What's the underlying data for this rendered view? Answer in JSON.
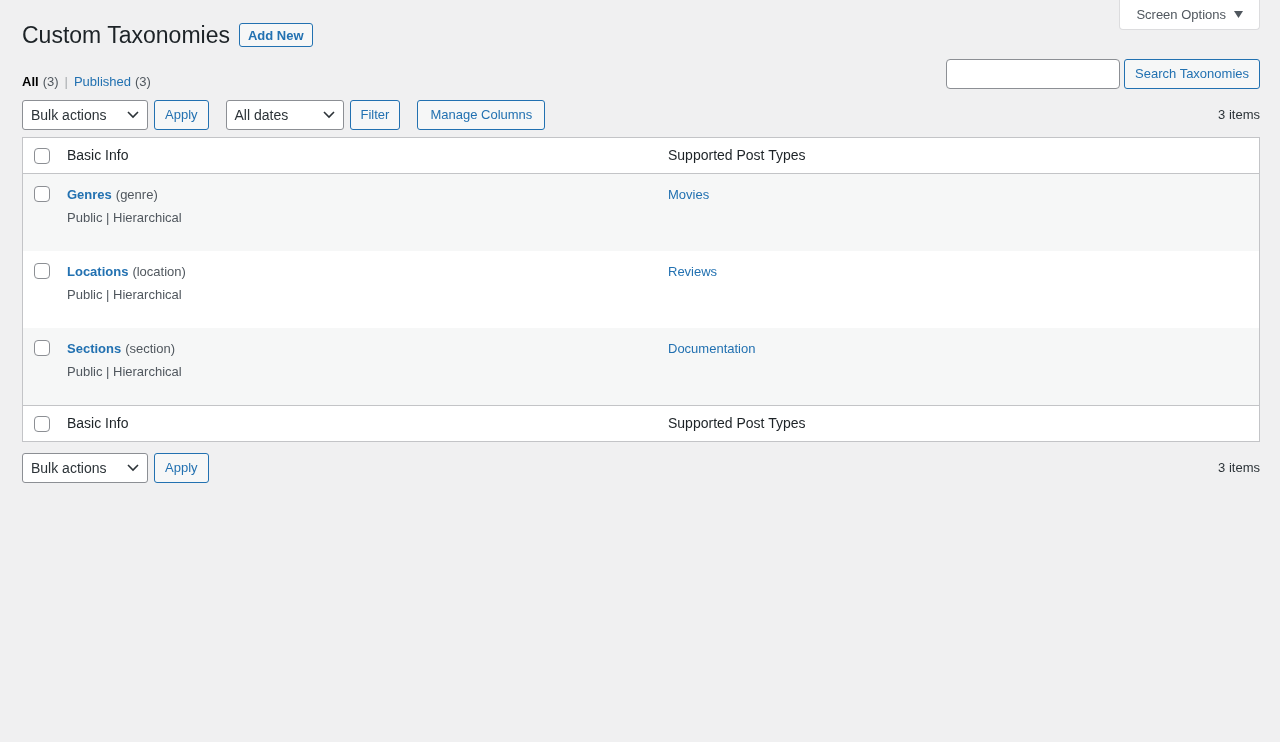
{
  "screen_options": {
    "label": "Screen Options",
    "expanded": false
  },
  "page_title": "Custom Taxonomies",
  "add_new": "Add New",
  "views": [
    {
      "label": "All",
      "count": "(3)",
      "selected": true
    },
    {
      "label": "Published",
      "count": "(3)",
      "selected": false
    }
  ],
  "view_separator": "|",
  "search": {
    "button": "Search Taxonomies"
  },
  "top_nav": {
    "bulk_actions": "Bulk actions",
    "apply": "Apply",
    "dates": "All dates",
    "filter": "Filter",
    "manage_columns": "Manage Columns",
    "count": "3 items"
  },
  "table": {
    "columns": [
      "Basic Info",
      "Supported Post Types"
    ],
    "select_all_checked": false,
    "rows": [
      {
        "name": "Genres",
        "slug": "(genre)",
        "meta": "Public | Hierarchical",
        "post_types": "Movies",
        "checked": false
      },
      {
        "name": "Locations",
        "slug": "(location)",
        "meta": "Public | Hierarchical",
        "post_types": "Reviews",
        "checked": false
      },
      {
        "name": "Sections",
        "slug": "(section)",
        "meta": "Public | Hierarchical",
        "post_types": "Documentation",
        "checked": false
      }
    ],
    "footer_columns": [
      "Basic Info",
      "Supported Post Types"
    ],
    "footer_select_all_checked": false
  },
  "bottom_nav": {
    "bulk_actions": "Bulk actions",
    "apply": "Apply",
    "count": "3 items"
  }
}
